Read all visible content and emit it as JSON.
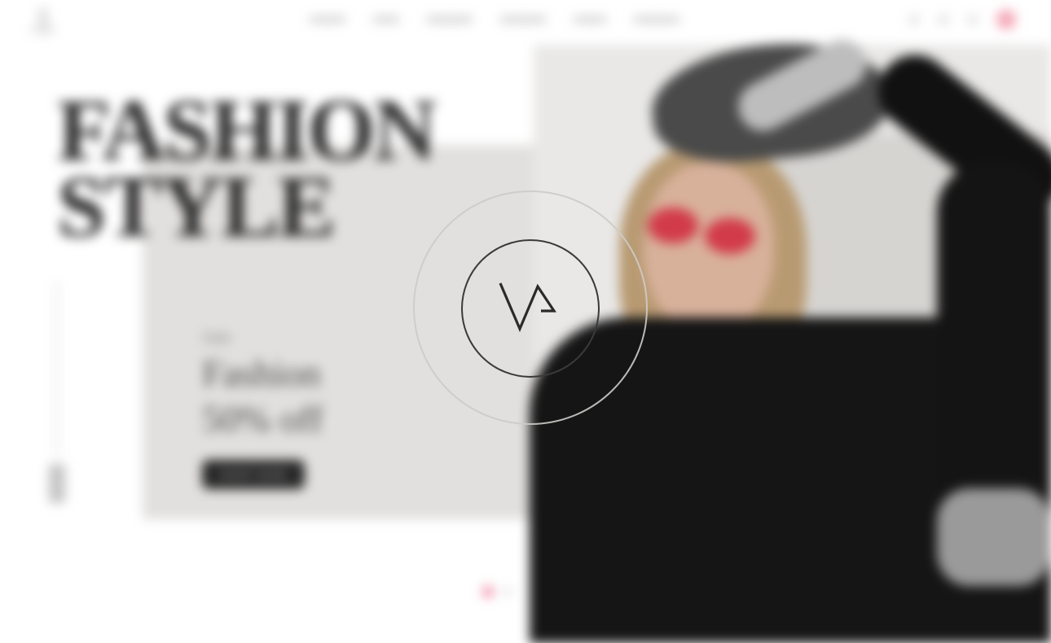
{
  "header": {
    "nav_items": [
      "Home",
      "Shop",
      "Product",
      "Blog",
      "Pages",
      "Contact"
    ],
    "icons": [
      "search-icon",
      "user-icon",
      "heart-icon",
      "cart-icon"
    ]
  },
  "hero": {
    "headline_line1": "FASHION",
    "headline_line2": "STYLE",
    "promo_small": "Sale",
    "promo_line1": "Fashion",
    "promo_line2": "50% off",
    "cta_label": "SHOP NOW"
  },
  "loader": {
    "mark": "VA"
  },
  "colors": {
    "accent": "#f08aa1",
    "dark": "#262626",
    "panel": "#e2e0de"
  }
}
